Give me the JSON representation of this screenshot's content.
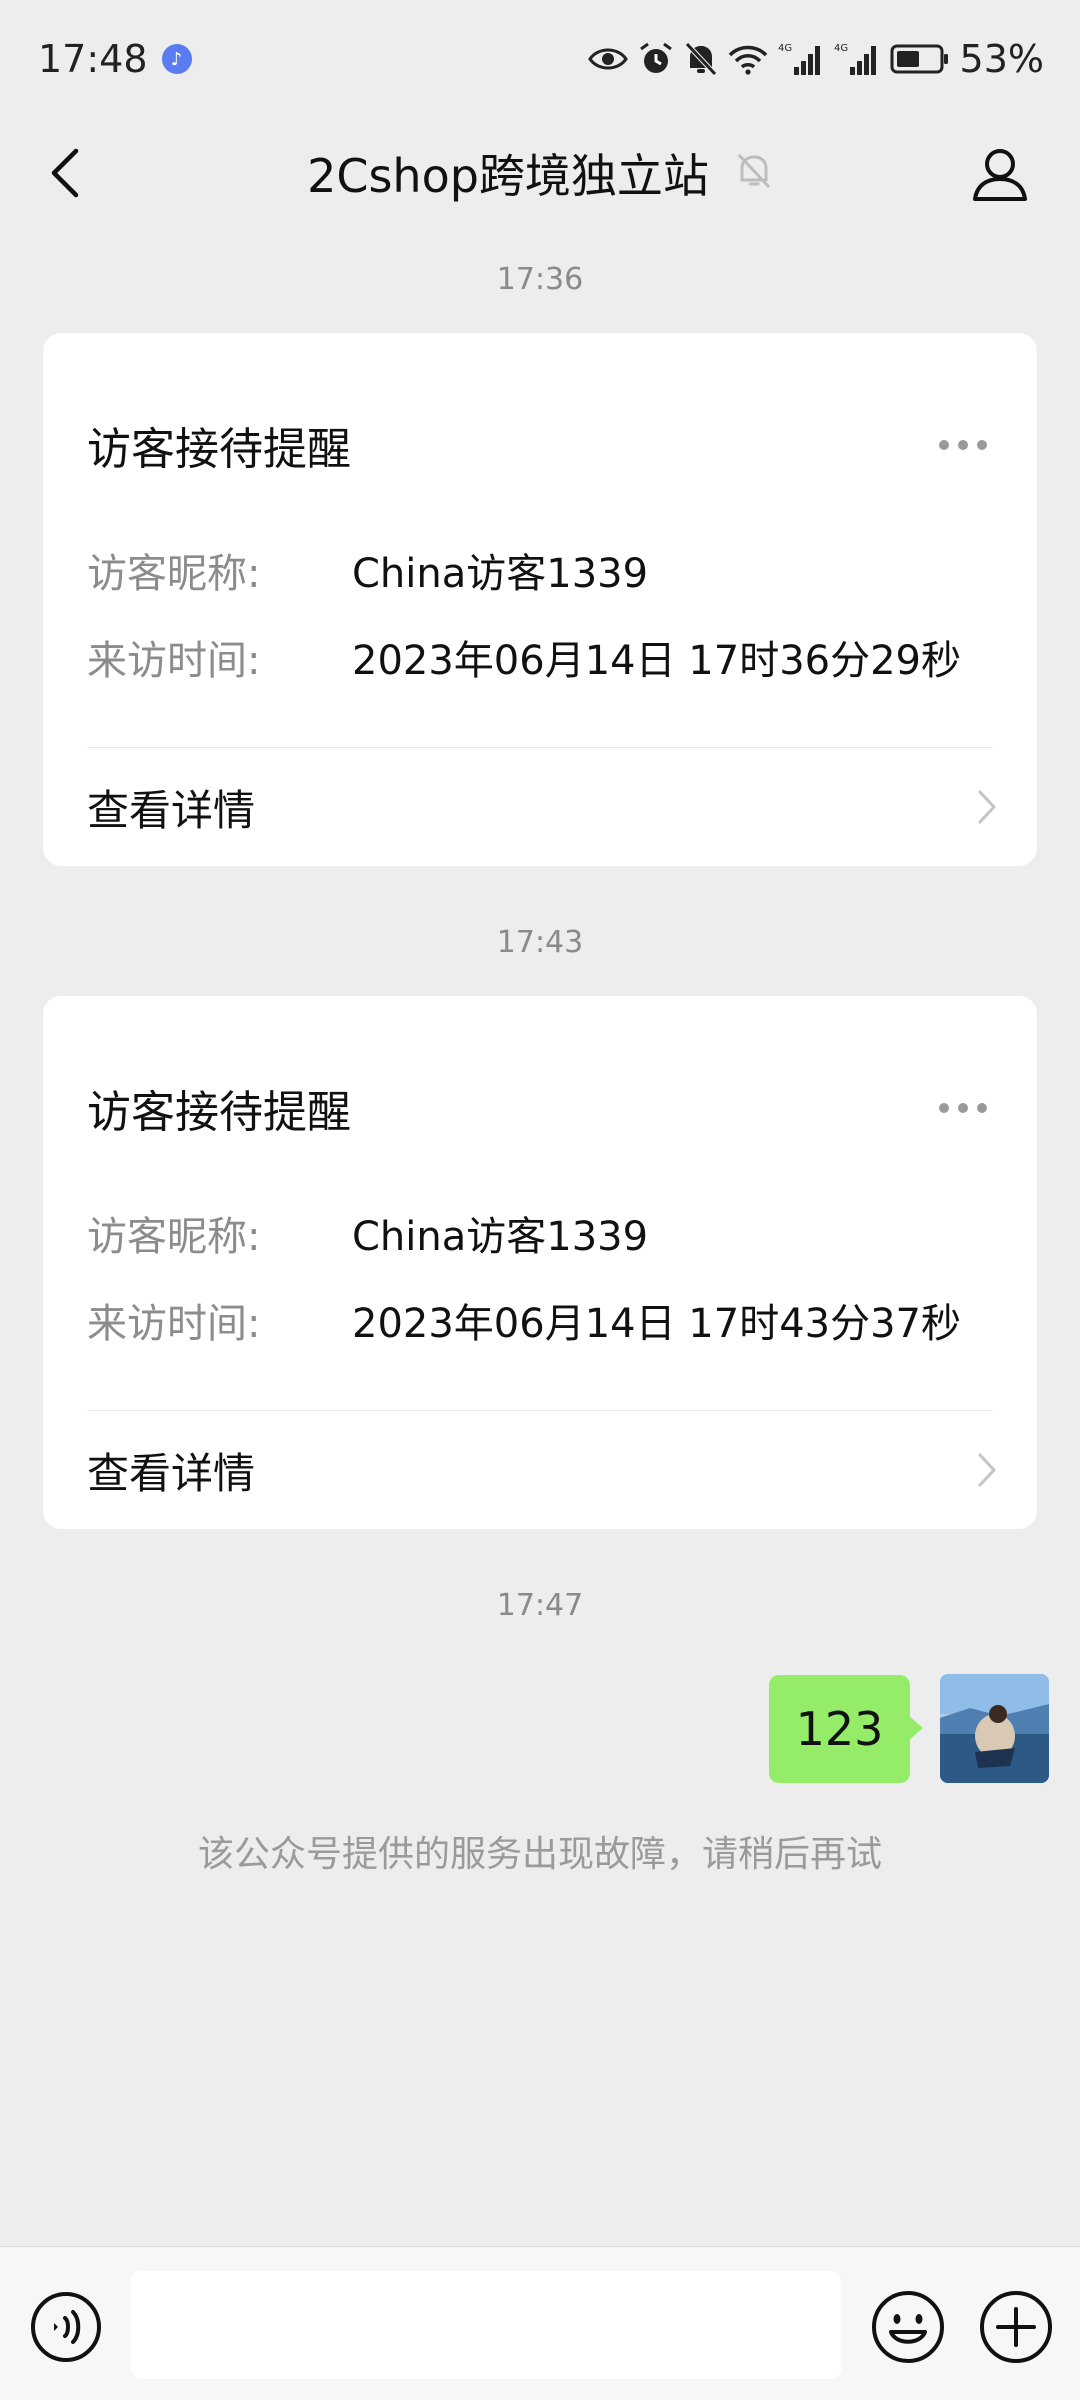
{
  "status_bar": {
    "time": "17:48",
    "battery": "53%",
    "network_1": "4G",
    "network_2": "4G",
    "icons": [
      "music-icon",
      "eye-icon",
      "alarm-icon",
      "mute-bell-icon",
      "wifi-icon",
      "signal-icon",
      "signal-icon",
      "battery-icon"
    ]
  },
  "nav": {
    "title": "2Cshop跨境独立站",
    "icons": [
      "back-arrow-icon",
      "muted-bell-icon",
      "profile-icon"
    ]
  },
  "messages": [
    {
      "timestamp": "17:36",
      "card": {
        "title": "访客接待提醒",
        "fields": [
          {
            "label": "访客昵称:",
            "value": "China访客1339"
          },
          {
            "label": "来访时间:",
            "value": "2023年06月14日 17时36分29秒"
          }
        ],
        "link_label": "查看详情"
      }
    },
    {
      "timestamp": "17:43",
      "card": {
        "title": "访客接待提醒",
        "fields": [
          {
            "label": "访客昵称:",
            "value": "China访客1339"
          },
          {
            "label": "来访时间:",
            "value": "2023年06月14日 17时43分37秒"
          }
        ],
        "link_label": "查看详情"
      }
    },
    {
      "timestamp": "17:47",
      "outgoing_text": "123"
    }
  ],
  "system_note": "该公众号提供的服务出现故障，请稍后再试",
  "input_bar": {
    "value": "",
    "icons": [
      "voice-icon",
      "emoji-icon",
      "plus-icon"
    ]
  },
  "colors": {
    "background": "#ededed",
    "bubble": "#95ec69",
    "card": "#ffffff",
    "muted_text": "#8c8c8c"
  }
}
